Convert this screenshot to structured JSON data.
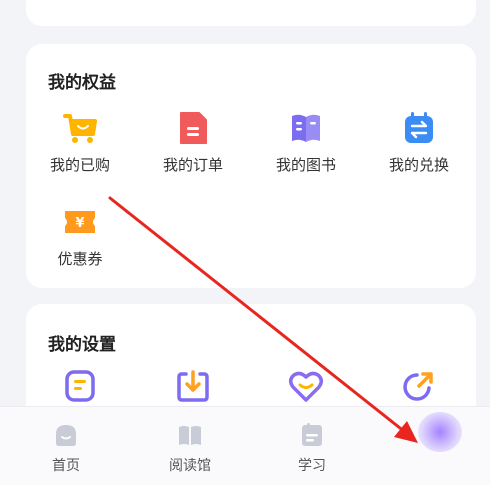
{
  "benefits": {
    "title": "我的权益",
    "items": [
      {
        "label": "我的已购",
        "icon": "shopping-cart-icon",
        "color": "#ffb400"
      },
      {
        "label": "我的订单",
        "icon": "order-document-icon",
        "color": "#f05a5a"
      },
      {
        "label": "我的图书",
        "icon": "book-icon",
        "color": "#7c6cf0"
      },
      {
        "label": "我的兑换",
        "icon": "exchange-icon",
        "color": "#3b8cf5"
      },
      {
        "label": "优惠券",
        "icon": "coupon-icon",
        "color": "#ff9a1f"
      }
    ]
  },
  "settings": {
    "title": "我的设置",
    "items": [
      {
        "icon": "notes-icon",
        "color": "#7c6cf0"
      },
      {
        "icon": "download-icon",
        "color": "#ffa020"
      },
      {
        "icon": "heart-icon",
        "color": "#8a6cf0"
      },
      {
        "icon": "share-icon",
        "color": "#7c6cf0"
      }
    ]
  },
  "tabbar": {
    "tabs": [
      {
        "label": "首页",
        "icon": "home-icon"
      },
      {
        "label": "阅读馆",
        "icon": "reading-hall-icon"
      },
      {
        "label": "学习",
        "icon": "study-icon"
      }
    ]
  },
  "colors": {
    "annotation_arrow": "#e8251e",
    "tab_icon": "#c8ccd6",
    "glow": "#9a78ff"
  }
}
